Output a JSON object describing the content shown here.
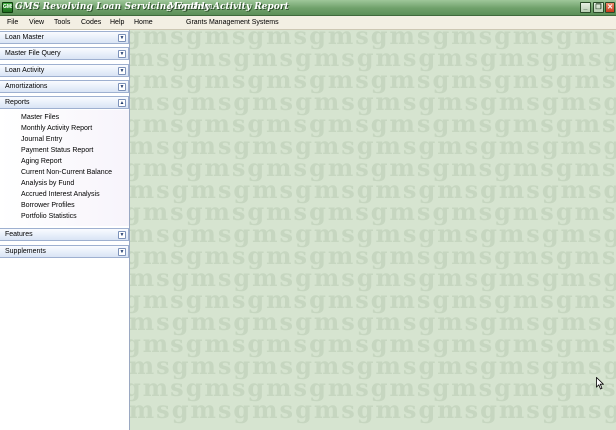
{
  "titlebar": {
    "app_title": "GMS Revolving Loan Servicing System",
    "document_title": "Monthly Activity Report",
    "icon_text": "GMS"
  },
  "menubar": {
    "items": [
      "File",
      "View",
      "Tools",
      "Codes",
      "Help",
      "Home"
    ],
    "banner": "Grants Management Systems"
  },
  "sidebar": {
    "sections": [
      {
        "label": "Loan Master",
        "state": "collapsed"
      },
      {
        "label": "Master File Query",
        "state": "collapsed"
      },
      {
        "label": "Loan Activity",
        "state": "collapsed"
      },
      {
        "label": "Amortizations",
        "state": "collapsed"
      },
      {
        "label": "Reports",
        "state": "expanded"
      },
      {
        "label": "Features",
        "state": "collapsed"
      },
      {
        "label": "Supplements",
        "state": "collapsed"
      }
    ],
    "reports_items": [
      "Master Files",
      "Monthly Activity Report",
      "Journal Entry",
      "Payment Status Report",
      "Aging Report",
      "Current Non-Current Balance",
      "Analysis by Fund",
      "Accrued Interest Analysis",
      "Borrower Profiles",
      "Portfolio Statistics"
    ]
  },
  "colors": {
    "titlebar": "#6fa06a",
    "workspace": "#d6e4d0",
    "section_header": "#d9e4f5"
  },
  "icons": {
    "collapsed": "chevron-down-icon",
    "expanded": "chevron-up-icon"
  }
}
